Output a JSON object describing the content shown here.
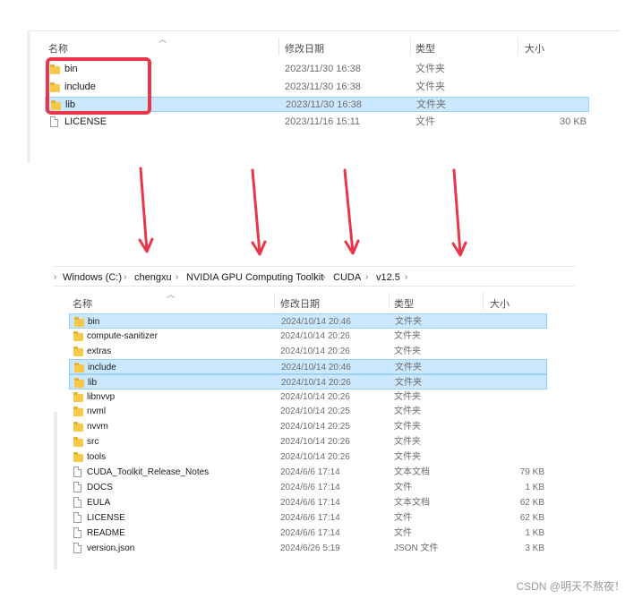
{
  "top_pane": {
    "columns": {
      "name": "名称",
      "modified": "修改日期",
      "type": "类型",
      "size": "大小"
    },
    "rows": [
      {
        "name": "bin",
        "modified": "2023/11/30 16:38",
        "type": "文件夹",
        "size": "",
        "icon": "folder-icon",
        "selected": false
      },
      {
        "name": "include",
        "modified": "2023/11/30 16:38",
        "type": "文件夹",
        "size": "",
        "icon": "folder-icon",
        "selected": false
      },
      {
        "name": "lib",
        "modified": "2023/11/30 16:38",
        "type": "文件夹",
        "size": "",
        "icon": "folder-icon",
        "selected": true
      },
      {
        "name": "LICENSE",
        "modified": "2023/11/16 15:11",
        "type": "文件",
        "size": "30 KB",
        "icon": "file-icon",
        "selected": false
      }
    ],
    "highlight_color": "#e8364b"
  },
  "arrows": {
    "color": "#e8364b",
    "count": 4
  },
  "bottom_pane": {
    "breadcrumb": [
      "Windows (C:)",
      "chengxu",
      "NVIDIA GPU Computing Toolkit",
      "CUDA",
      "v12.5"
    ],
    "columns": {
      "name": "名称",
      "modified": "修改日期",
      "type": "类型",
      "size": "大小"
    },
    "rows": [
      {
        "name": "bin",
        "modified": "2024/10/14 20:46",
        "type": "文件夹",
        "size": "",
        "icon": "folder-icon",
        "selected": true
      },
      {
        "name": "compute-sanitizer",
        "modified": "2024/10/14 20:26",
        "type": "文件夹",
        "size": "",
        "icon": "folder-icon",
        "selected": false
      },
      {
        "name": "extras",
        "modified": "2024/10/14 20:26",
        "type": "文件夹",
        "size": "",
        "icon": "folder-icon",
        "selected": false
      },
      {
        "name": "include",
        "modified": "2024/10/14 20:46",
        "type": "文件夹",
        "size": "",
        "icon": "folder-icon",
        "selected": true
      },
      {
        "name": "lib",
        "modified": "2024/10/14 20:26",
        "type": "文件夹",
        "size": "",
        "icon": "folder-icon",
        "selected": true
      },
      {
        "name": "libnvvp",
        "modified": "2024/10/14 20:26",
        "type": "文件夹",
        "size": "",
        "icon": "folder-icon",
        "selected": false
      },
      {
        "name": "nvml",
        "modified": "2024/10/14 20:25",
        "type": "文件夹",
        "size": "",
        "icon": "folder-icon",
        "selected": false
      },
      {
        "name": "nvvm",
        "modified": "2024/10/14 20:25",
        "type": "文件夹",
        "size": "",
        "icon": "folder-icon",
        "selected": false
      },
      {
        "name": "src",
        "modified": "2024/10/14 20:26",
        "type": "文件夹",
        "size": "",
        "icon": "folder-icon",
        "selected": false
      },
      {
        "name": "tools",
        "modified": "2024/10/14 20:26",
        "type": "文件夹",
        "size": "",
        "icon": "folder-icon",
        "selected": false
      },
      {
        "name": "CUDA_Toolkit_Release_Notes",
        "modified": "2024/6/6 17:14",
        "type": "文本文档",
        "size": "79 KB",
        "icon": "file-icon",
        "selected": false
      },
      {
        "name": "DOCS",
        "modified": "2024/6/6 17:14",
        "type": "文件",
        "size": "1 KB",
        "icon": "file-icon",
        "selected": false
      },
      {
        "name": "EULA",
        "modified": "2024/6/6 17:14",
        "type": "文本文档",
        "size": "62 KB",
        "icon": "file-icon",
        "selected": false
      },
      {
        "name": "LICENSE",
        "modified": "2024/6/6 17:14",
        "type": "文件",
        "size": "62 KB",
        "icon": "file-icon",
        "selected": false
      },
      {
        "name": "README",
        "modified": "2024/6/6 17:14",
        "type": "文件",
        "size": "1 KB",
        "icon": "file-icon",
        "selected": false
      },
      {
        "name": "version.json",
        "modified": "2024/6/26 5:19",
        "type": "JSON 文件",
        "size": "3 KB",
        "icon": "file-icon",
        "selected": false
      }
    ]
  },
  "watermark": "CSDN @明天不熬夜！"
}
